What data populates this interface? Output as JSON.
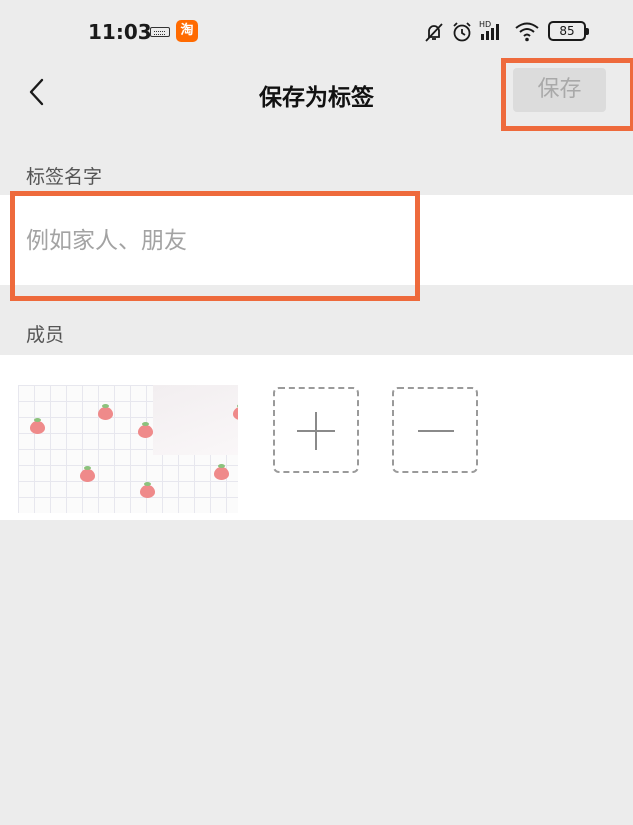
{
  "status_bar": {
    "time": "11:03",
    "icons": [
      "keyboard-icon",
      "taobao-app-icon",
      "mute-icon",
      "alarm-icon",
      "hd-signal-icon",
      "wifi-icon",
      "battery-icon"
    ],
    "taobao_glyph": "淘",
    "signal_label": "HD",
    "battery_level": "85"
  },
  "nav": {
    "back_icon": "chevron-left-icon",
    "title": "保存为标签",
    "save_label": "保存"
  },
  "tag_name": {
    "label": "标签名字",
    "placeholder": "例如家人、朋友",
    "value": ""
  },
  "members": {
    "label": "成员",
    "avatar_icon": "strawberry-pattern-avatar",
    "add_icon": "plus-icon",
    "remove_icon": "minus-icon"
  },
  "colors": {
    "background": "#ececec",
    "panel": "#ffffff",
    "highlight_border": "#ee6a3c",
    "save_disabled_text": "#a9a9a9",
    "save_disabled_bg": "#dcdcdc"
  }
}
